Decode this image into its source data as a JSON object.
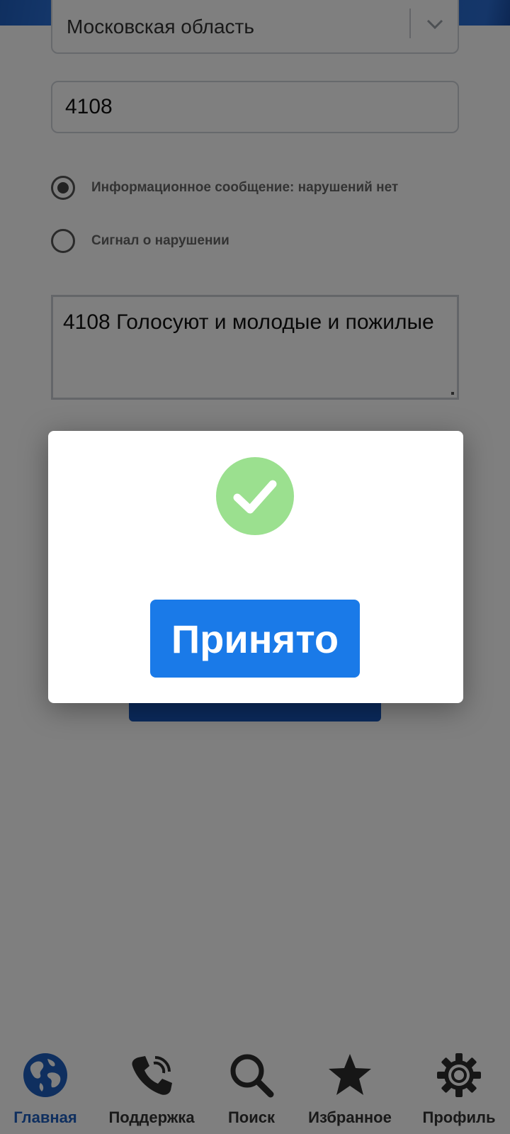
{
  "form": {
    "region": "Московская область",
    "precinct_number": "4108",
    "radio_options": [
      {
        "label": "Информационное сообщение: нарушений нет",
        "checked": true
      },
      {
        "label": "Сигнал о нарушении",
        "checked": false
      }
    ],
    "message_text": "4108 Голосуют и молодые и пожилые"
  },
  "dialog": {
    "status_icon": "check-circle-icon",
    "accept_label": "Принято",
    "colors": {
      "success": "#9be08f",
      "accept_button": "#1a7ae8"
    }
  },
  "colors": {
    "header": "#2a6dd3",
    "submit_button": "#1754b8",
    "nav_active": "#1e5fbf"
  },
  "nav": {
    "items": [
      {
        "label": "Главная",
        "icon": "globe-icon",
        "active": true
      },
      {
        "label": "Поддержка",
        "icon": "phone-icon",
        "active": false
      },
      {
        "label": "Поиск",
        "icon": "search-icon",
        "active": false
      },
      {
        "label": "Избранное",
        "icon": "star-icon",
        "active": false
      },
      {
        "label": "Профиль",
        "icon": "gear-icon",
        "active": false
      }
    ]
  }
}
